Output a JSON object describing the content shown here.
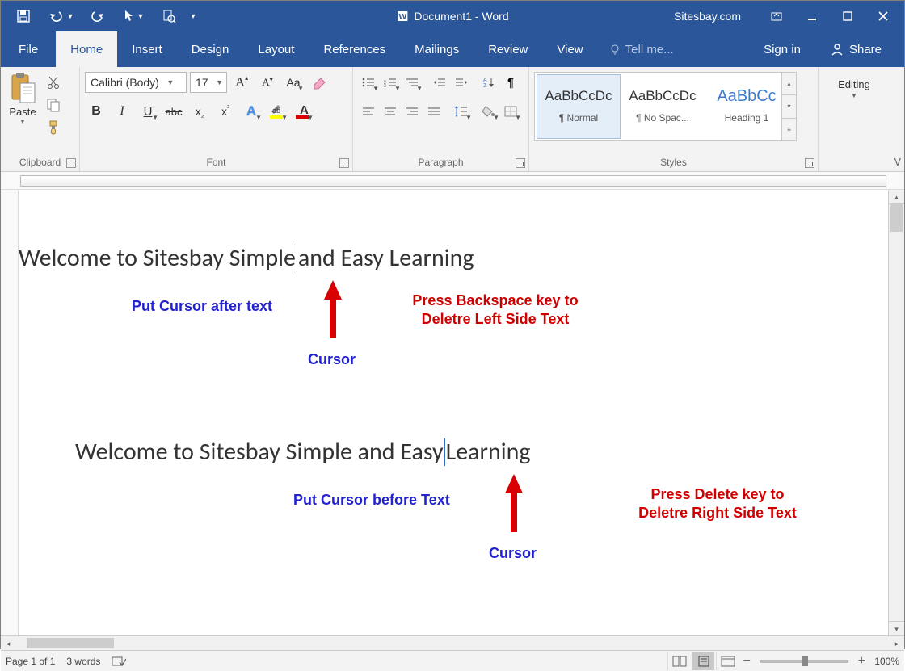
{
  "title": {
    "doc": "Document1 - Word",
    "site": "Sitesbay.com"
  },
  "tabs": {
    "file": "File",
    "home": "Home",
    "insert": "Insert",
    "design": "Design",
    "layout": "Layout",
    "references": "References",
    "mailings": "Mailings",
    "review": "Review",
    "view": "View",
    "tellme": "Tell me...",
    "signin": "Sign in",
    "share": "Share"
  },
  "ribbon": {
    "clipboard": {
      "label": "Clipboard",
      "paste": "Paste"
    },
    "font": {
      "label": "Font",
      "name": "Calibri (Body)",
      "size": "17"
    },
    "paragraph": {
      "label": "Paragraph"
    },
    "styles": {
      "label": "Styles",
      "items": [
        {
          "preview": "AaBbCcDc",
          "name": "¶ Normal"
        },
        {
          "preview": "AaBbCcDc",
          "name": "¶ No Spac..."
        },
        {
          "preview": "AaBbCc",
          "name": "Heading 1"
        }
      ]
    },
    "editing": {
      "label": "Editing"
    }
  },
  "document": {
    "line1": {
      "before": "Welcome to Sitesbay Simple",
      "after": " and Easy Learning"
    },
    "line2": {
      "before": "Welcome to Sitesbay Simple and Easy ",
      "after": "Learning"
    },
    "ann1_left": "Put Cursor after text",
    "ann1_cursor": "Cursor",
    "ann1_right_l1": "Press Backspace key to",
    "ann1_right_l2": "Deletre Left Side Text",
    "ann2_left": "Put Cursor before Text",
    "ann2_cursor": "Cursor",
    "ann2_right_l1": "Press Delete key to",
    "ann2_right_l2": "Deletre Right Side Text"
  },
  "status": {
    "page": "Page 1 of 1",
    "words": "3 words",
    "zoom": "100%"
  }
}
